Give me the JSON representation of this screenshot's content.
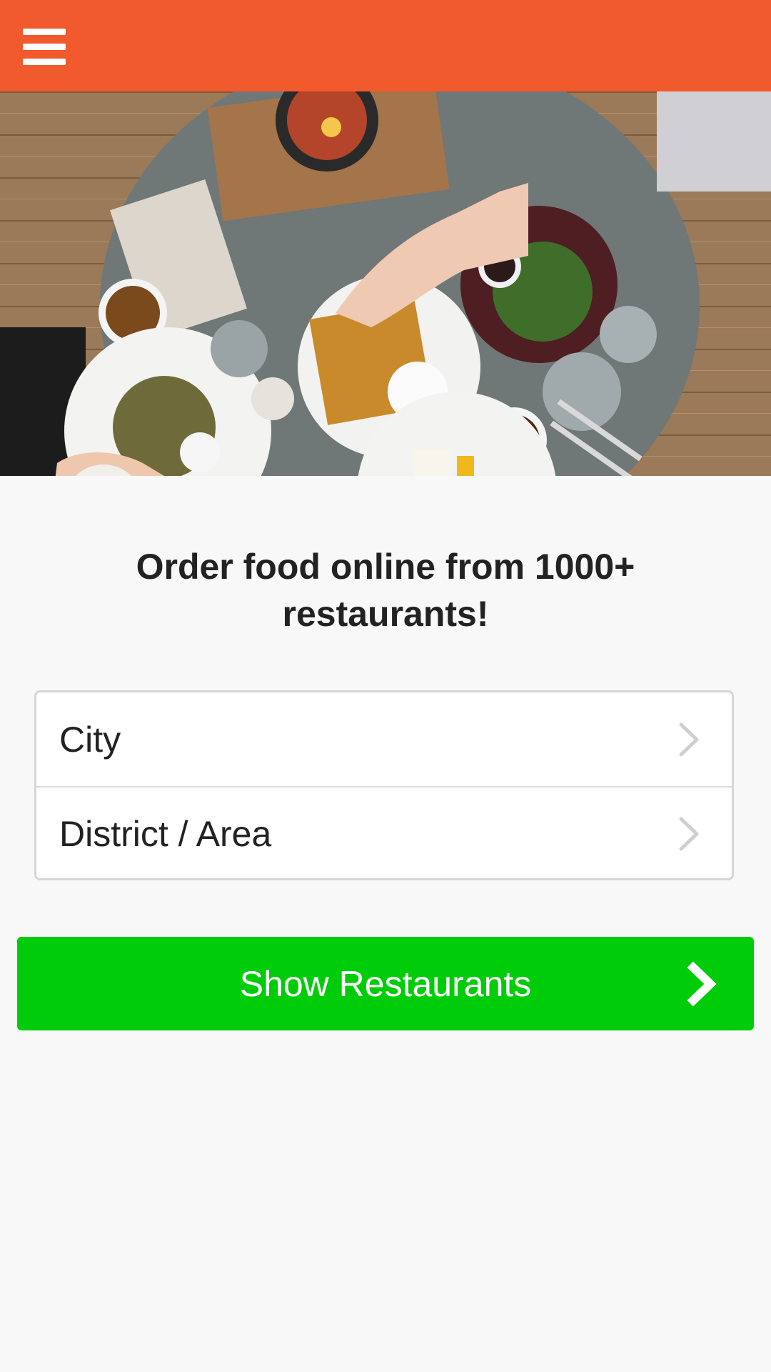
{
  "app": {
    "header_color": "#f15a2c",
    "menu_icon": "hamburger-menu-icon"
  },
  "hero": {
    "image_subject": "overhead view of a breakfast table with waffles, coffee and plates"
  },
  "main": {
    "headline": "Order food online from 1000+ restaurants!"
  },
  "location_selector": {
    "city_label": "City",
    "area_label": "District / Area",
    "chevron_icon": "chevron-right-icon"
  },
  "cta": {
    "label": "Show Restaurants",
    "color": "#00cc0a",
    "icon": "chevron-right-icon"
  }
}
